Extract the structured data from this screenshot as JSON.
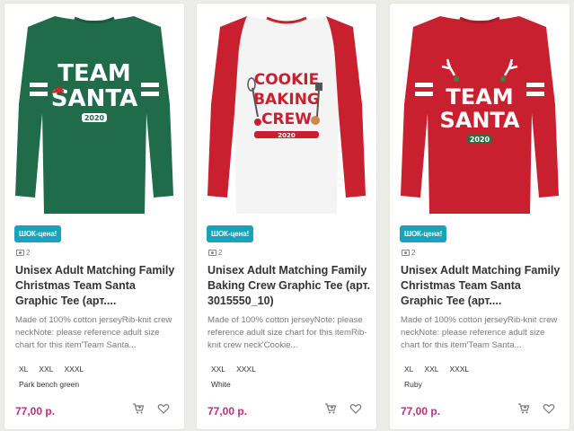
{
  "products": [
    {
      "badge": "ШОК-цена!",
      "photos": "2",
      "title": "Unisex Adult Matching Family Christmas Team Santa Graphic Tee (арт....",
      "description": "Made of 100% cotton jerseyRib-knit crew neckNote: please reference adult size chart for this item'Team Santa...",
      "sizes": [
        "XL",
        "XXL",
        "XXXL"
      ],
      "color": "Park bench green",
      "price": "77,00 р.",
      "print": {
        "l1": "TEAM",
        "l2": "SANTA",
        "l3": "2020"
      }
    },
    {
      "badge": "ШОК-цена!",
      "photos": "2",
      "title": "Unisex Adult Matching Family Baking Crew Graphic Tee (арт. 3015550_10)",
      "description": "Made of 100% cotton jerseyNote: please reference adult size chart for this itemRib-knit crew neck'Cookie...",
      "sizes": [
        "XXL",
        "XXXL"
      ],
      "color": "White",
      "price": "77,00 р.",
      "print": {
        "l1": "COOKIE",
        "l2": "BAKING",
        "l3": "CREW",
        "l4": "2020"
      }
    },
    {
      "badge": "ШОК-цена!",
      "photos": "2",
      "title": "Unisex Adult Matching Family Christmas Team Santa Graphic Tee (арт....",
      "description": "Made of 100% cotton jerseyRib-knit crew neckNote: please reference adult size chart for this item'Team Santa...",
      "sizes": [
        "XL",
        "XXL",
        "XXXL"
      ],
      "color": "Ruby",
      "price": "77,00 р.",
      "print": {
        "l1": "TEAM",
        "l2": "SANTA",
        "l3": "2020"
      }
    }
  ],
  "icons": {
    "cart": "cart-icon",
    "favorite": "heart-icon",
    "photos": "camera-icon"
  },
  "colors": {
    "badge": "#17a3b8",
    "price": "#b9317e",
    "green_shirt": "#1f6b4a",
    "red_shirt": "#c8202f",
    "white_shirt": "#f4f4f4"
  }
}
